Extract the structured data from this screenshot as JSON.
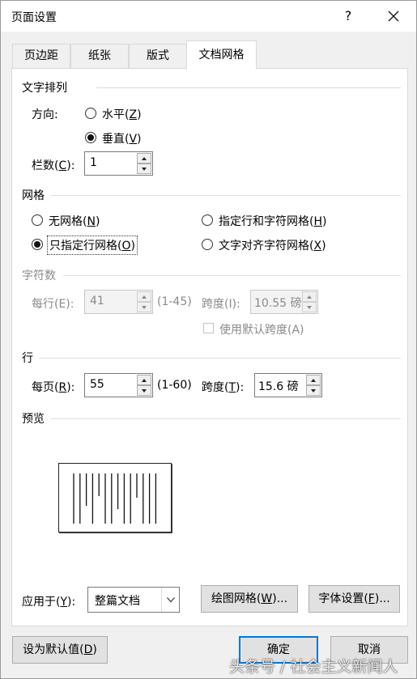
{
  "window": {
    "title": "页面设置",
    "help": "?"
  },
  "tabs": [
    {
      "label": "页边距"
    },
    {
      "label": "纸张"
    },
    {
      "label": "版式"
    },
    {
      "label": "文档网格"
    }
  ],
  "text_direction": {
    "group_title": "文字排列",
    "direction_label": "方向:",
    "horizontal": {
      "text": "水平(",
      "key": "Z",
      "end": ")"
    },
    "vertical": {
      "text": "垂直(",
      "key": "V",
      "end": ")"
    },
    "selected": "vertical",
    "columns_label_pre": "栏数(",
    "columns_key": "C",
    "columns_label_post": "):",
    "columns_value": "1"
  },
  "grid": {
    "group_title": "网格",
    "options": [
      {
        "pre": "无网格(",
        "key": "N",
        "post": ")",
        "checked": false
      },
      {
        "pre": "指定行和字符网格(",
        "key": "H",
        "post": ")",
        "checked": false
      },
      {
        "pre": "只指定行网格(",
        "key": "O",
        "post": ")",
        "checked": true
      },
      {
        "pre": "文字对齐字符网格(",
        "key": "X",
        "post": ")",
        "checked": false
      }
    ]
  },
  "chars": {
    "group_title": "字符数",
    "per_line_label": "每行(E):",
    "per_line_value": "41",
    "per_line_range": "(1-45)",
    "pitch_label": "跨度(I):",
    "pitch_value": "10.55 磅",
    "default_pitch": "使用默认跨度(A)",
    "default_pitch_checked": false
  },
  "lines": {
    "group_title": "行",
    "per_page_pre": "每页(",
    "per_page_key": "R",
    "per_page_post": "):",
    "per_page_value": "55",
    "per_page_range": "(1-60)",
    "pitch_pre": "跨度(",
    "pitch_key": "T",
    "pitch_post": "):",
    "pitch_value": "15.6 磅"
  },
  "preview": {
    "group_title": "预览",
    "columns": 14
  },
  "apply": {
    "label_pre": "应用于(",
    "label_key": "Y",
    "label_post": "):",
    "value": "整篇文档"
  },
  "buttons": {
    "drawing_grid": {
      "pre": "绘图网格(",
      "key": "W",
      "post": ")..."
    },
    "font_settings": {
      "pre": "字体设置(",
      "key": "F",
      "post": ")..."
    },
    "set_default": {
      "pre": "设为默认值(",
      "key": "D",
      "post": ")"
    },
    "ok": "确定",
    "cancel": "取消"
  },
  "watermark": "头条号 / 社会主义新闻人",
  "colors": {
    "accent": "#0078d7",
    "window_bg": "#f0f0f0",
    "panel_bg": "#ffffff"
  }
}
